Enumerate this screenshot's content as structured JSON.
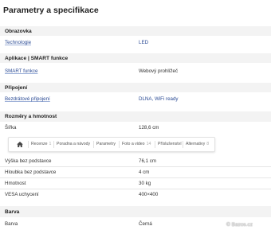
{
  "page_title": "Parametry a specifikace",
  "sections": {
    "obrazovka": {
      "header": "Obrazovka",
      "label": "Technologie",
      "value": "LED"
    },
    "aplikace": {
      "header": "Aplikace | SMART funkce",
      "label": "SMART funkce",
      "value": "Webový prohlížeč"
    },
    "pripojeni": {
      "header": "Připojení",
      "label": "Bezdrátové připojení",
      "value": "DLNA, WiFi ready"
    },
    "rozmery": {
      "header": "Rozměry a hmotnost",
      "sirka_label": "Šířka",
      "sirka_value": "128,6 cm",
      "vyska_label": "Výška bez podstavce",
      "vyska_value": "76,1 cm",
      "hloubka_label": "Hloubka bez podstavce",
      "hloubka_value": "4 cm",
      "hmotnost_label": "Hmotnost",
      "hmotnost_value": "30 kg",
      "vesa_label": "VESA uchycení",
      "vesa_value": "400×400"
    },
    "barva": {
      "header": "Barva",
      "label": "Barva",
      "value": "Černá"
    }
  },
  "tabs": {
    "home_icon": "home-icon",
    "recenze": "Recenze",
    "recenze_count": "1",
    "poradna": "Poradna a návody",
    "parametry": "Parametry",
    "foto": "Foto a video",
    "foto_count": "14",
    "prislusenstvi": "Příslušenství",
    "alternativy": "Alternativy",
    "alternativy_count": "8"
  },
  "watermark": "Bazos.cz",
  "colors": {
    "link": "#2a4a94",
    "band": "#f3f3f3"
  }
}
